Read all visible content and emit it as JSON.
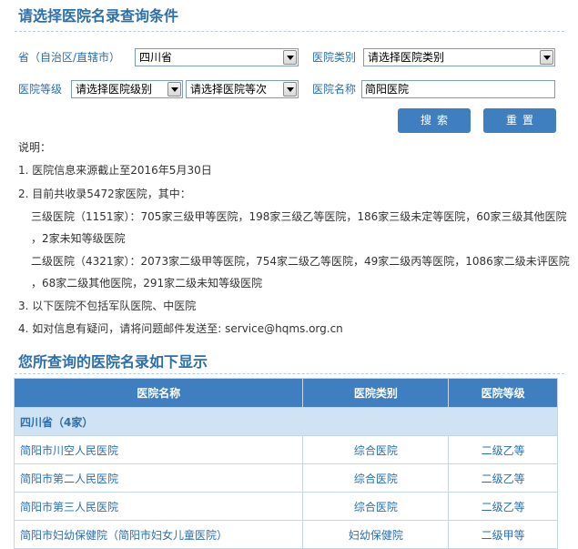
{
  "search": {
    "title": "请选择医院名录查询条件",
    "province_label": "省（自治区/直辖市）",
    "province_value": "四川省",
    "category_label": "医院类别",
    "category_value": "请选择医院类别",
    "level_label": "医院等级",
    "level_value": "请选择医院级别",
    "grade_value": "请选择医院等次",
    "name_label": "医院名称",
    "name_value": "简阳医院",
    "search_button": "搜索",
    "reset_button": "重置"
  },
  "notes": {
    "heading": "说明：",
    "line1": "1. 医院信息来源截止至2016年5月30日",
    "line2": "2. 目前共收录5472家医院，其中：",
    "line3a": "三级医院（1151家）：705家三级甲等医院，198家三级乙等医院，186家三级未定等医院，60家三级其他医院",
    "line3b": "，2家未知等级医院",
    "line4a": "二级医院（4321家）：2073家二级甲等医院，754家二级乙等医院，49家二级丙等医院，1086家二级未评医院",
    "line4b": "，68家二级其他医院，291家二级未知等级医院",
    "line5": "3. 以下医院不包括军队医院、中医院",
    "line6": "4. 如对信息有疑问，请将问题邮件发送至: service@hqms.org.cn"
  },
  "results": {
    "title": "您所查询的医院名录如下显示",
    "columns": {
      "name": "医院名称",
      "category": "医院类别",
      "level": "医院等级"
    },
    "province_group": "四川省（4家）",
    "rows": [
      {
        "name": "简阳市川空人民医院",
        "category": "综合医院",
        "level": "二级乙等"
      },
      {
        "name": "简阳市第二人民医院",
        "category": "综合医院",
        "level": "二级乙等"
      },
      {
        "name": "简阳市第三人民医院",
        "category": "综合医院",
        "level": "二级乙等"
      },
      {
        "name": "简阳市妇幼保健院（简阳市妇女儿童医院）",
        "category": "妇幼保健院",
        "level": "二级甲等"
      }
    ]
  }
}
